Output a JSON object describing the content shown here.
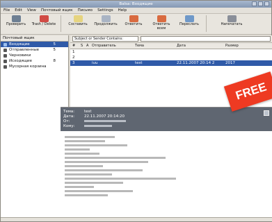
{
  "window": {
    "title": "Balsa: Входящие"
  },
  "menubar": [
    "File",
    "Edit",
    "View",
    "Почтовый ящик",
    "Письмо",
    "Settings",
    "Help"
  ],
  "toolbar": [
    {
      "label": "Проверить"
    },
    {
      "label": "Trash / Delete"
    },
    {
      "label": "Составить"
    },
    {
      "label": "Продолжить"
    },
    {
      "label": "Ответить"
    },
    {
      "label": "Ответить всем"
    },
    {
      "label": "Переслать"
    },
    {
      "label": "Напечатать"
    }
  ],
  "folders": {
    "header_label": "Почтовый ящик",
    "items": [
      {
        "label": "Входящие",
        "count": "5",
        "selected": true
      },
      {
        "label": "Отправленные",
        "count": "5"
      },
      {
        "label": "Черновики",
        "count": ""
      },
      {
        "label": "Исходящие",
        "count": "8"
      },
      {
        "label": "Мусорная корзина",
        "count": ""
      }
    ]
  },
  "filter": {
    "select_value": "Subject or Sender Contains:"
  },
  "message_list": {
    "columns": [
      "#",
      "S",
      "A",
      "Отправитель",
      "Тема",
      "Дата",
      "Размер"
    ],
    "rows": [
      {
        "num": "1",
        "status": "",
        "sender": "",
        "subject": "",
        "date": "",
        "size": ""
      },
      {
        "num": "2",
        "status": "",
        "sender": "",
        "subject": "",
        "date": "",
        "size": ""
      },
      {
        "num": "3",
        "status": "",
        "sender": "iuu",
        "subject": "test",
        "date": "22.11.2007 20:14 2",
        "size": "2017",
        "selected": true
      }
    ]
  },
  "preview": {
    "subject_label": "Тема:",
    "subject_value": "test",
    "date_label": "Дата:",
    "date_value": "22.11.2007 20:14:20",
    "from_label": "От:",
    "to_label": "Кому:"
  },
  "banner": {
    "text": "FREE"
  }
}
